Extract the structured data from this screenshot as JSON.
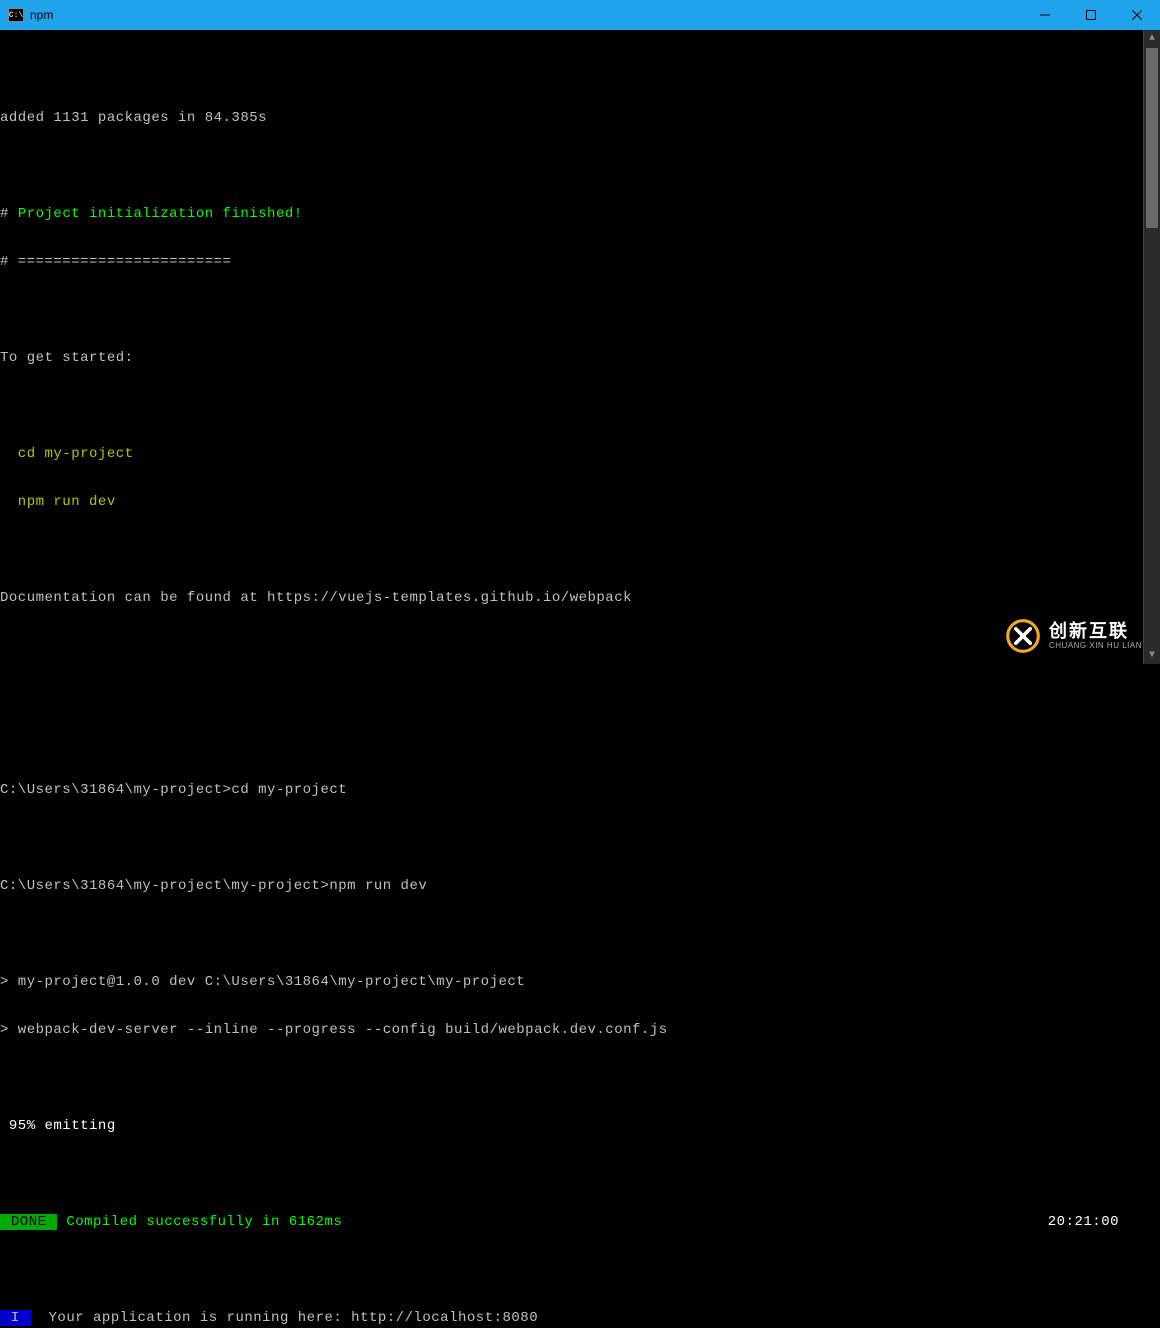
{
  "window": {
    "title": "npm",
    "icon_label": "C:\\"
  },
  "terminal": {
    "line_added": "added 1131 packages in 84.385s",
    "hash": "#",
    "init_finished": "Project initialization finished!",
    "divider": "# ========================",
    "get_started": "To get started:",
    "cmd_cd": "  cd my-project",
    "cmd_run": "  npm run dev",
    "docs": "Documentation can be found at https://vuejs-templates.github.io/webpack",
    "prompt1": "C:\\Users\\31864\\my-project>cd my-project",
    "prompt2": "C:\\Users\\31864\\my-project\\my-project>npm run dev",
    "script1": "> my-project@1.0.0 dev C:\\Users\\31864\\my-project\\my-project",
    "script2": "> webpack-dev-server --inline --progress --config build/webpack.dev.conf.js",
    "progress": " 95% emitting",
    "done_label": " DONE ",
    "compiled": " Compiled successfully in 6162ms",
    "timestamp": "20:21:00",
    "info_label": " I ",
    "running": "  Your application is running here: http://localhost:8080"
  },
  "watermark": {
    "cn": "创新互联",
    "en": "CHUANG XIN HU LIAN"
  }
}
